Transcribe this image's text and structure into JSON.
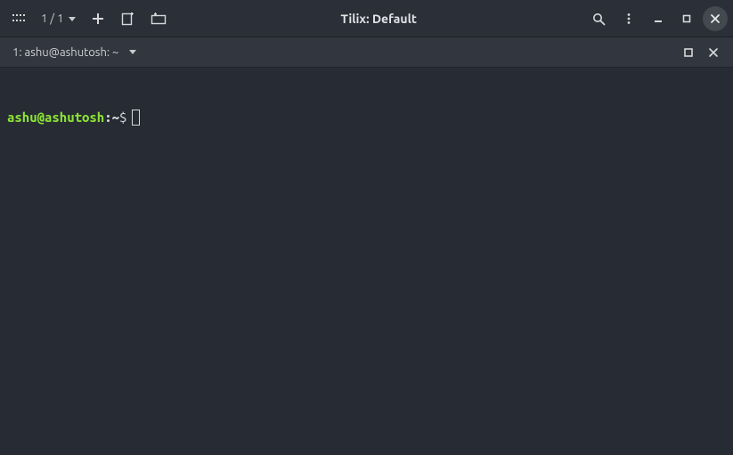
{
  "window": {
    "title": "Tilix: Default"
  },
  "titlebar": {
    "session_counter": "1 / 1"
  },
  "tab": {
    "label": "1: ashu@ashutosh: ~"
  },
  "terminal": {
    "prompt": {
      "user": "ashu@ashutosh",
      "separator": ":",
      "path": "~",
      "symbol": "$"
    }
  },
  "icons": {
    "app": "app-grid-icon",
    "plus": "plus-icon",
    "split_right": "split-right-icon",
    "split_down": "split-down-icon",
    "search": "search-icon",
    "menu": "kebab-menu-icon",
    "minimize": "minimize-icon",
    "maximize": "maximize-icon",
    "close": "close-icon",
    "tab_maximize": "pane-maximize-icon",
    "tab_close": "close-icon"
  }
}
